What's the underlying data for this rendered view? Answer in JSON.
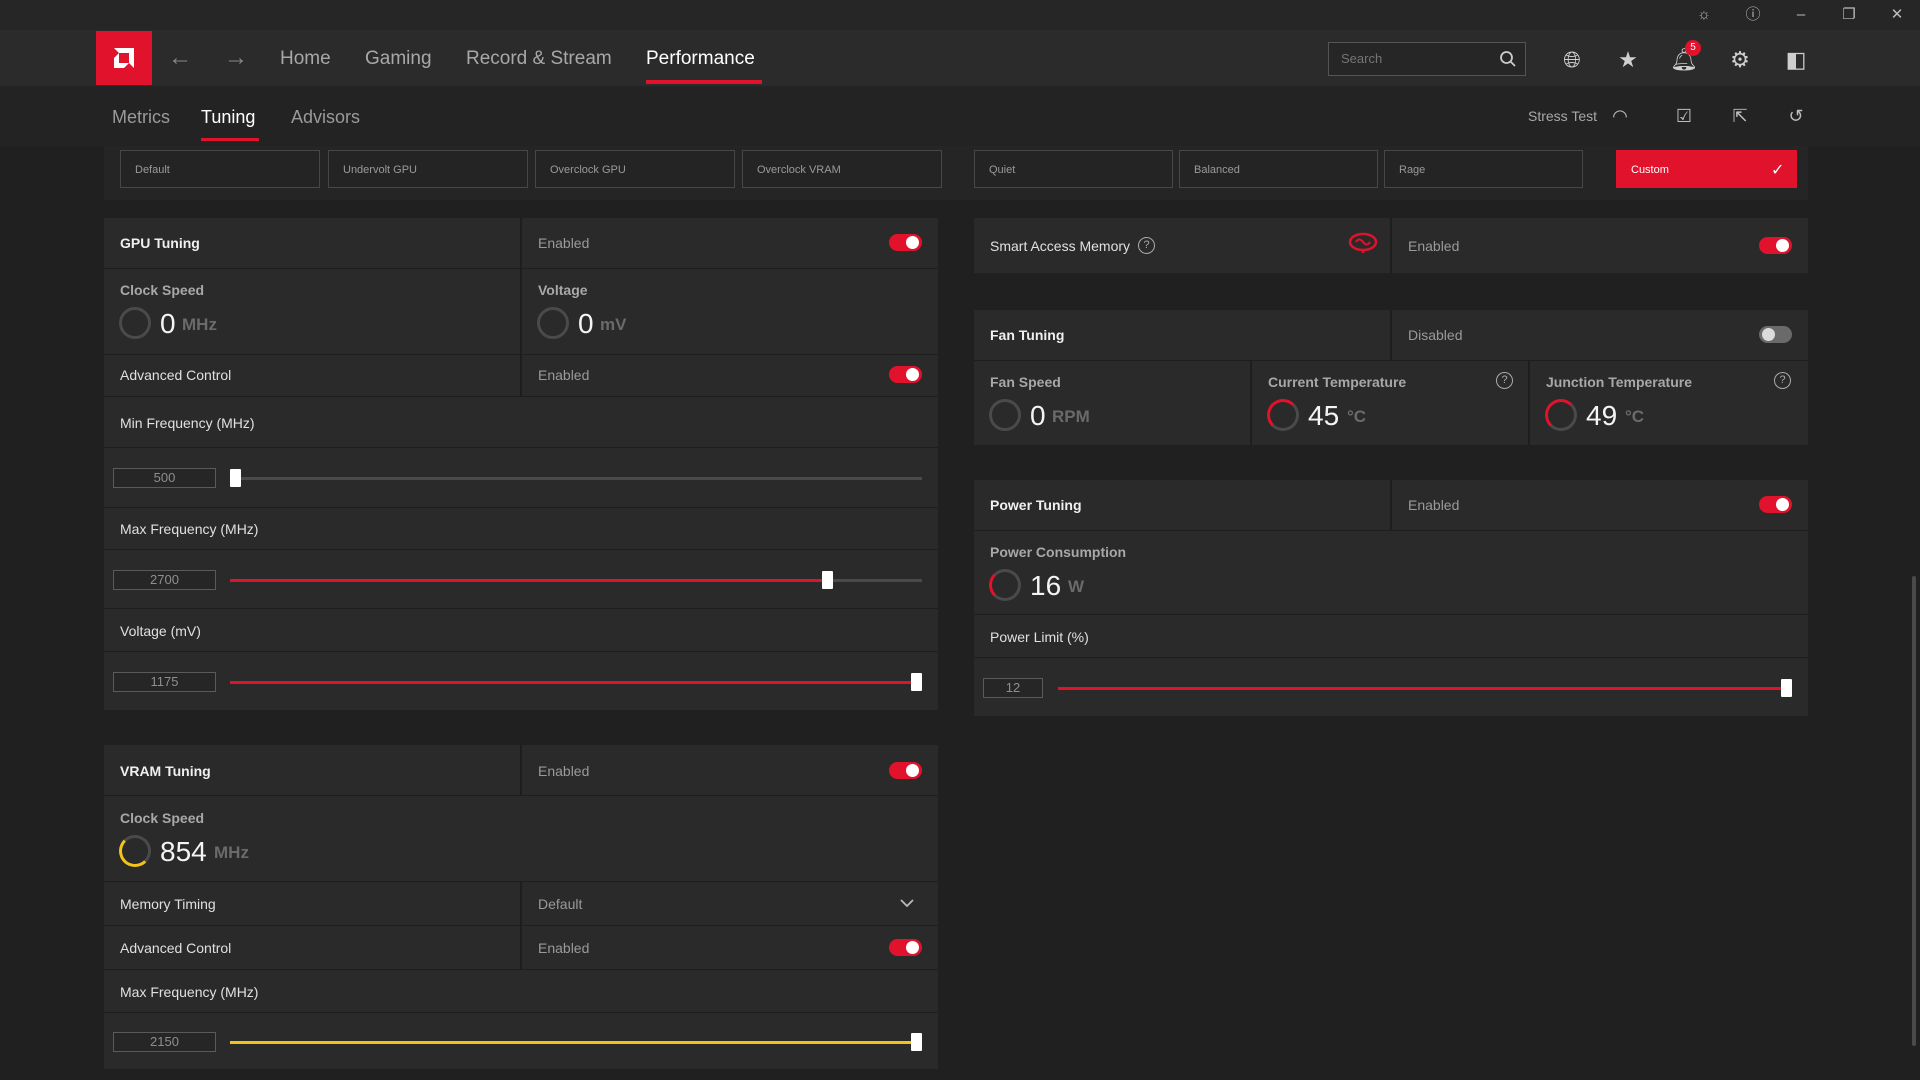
{
  "titlebar": {
    "icons": [
      "bug-icon",
      "help-icon",
      "minimize-icon",
      "restore-icon",
      "close-icon"
    ]
  },
  "nav": {
    "links": [
      "Home",
      "Gaming",
      "Record & Stream",
      "Performance"
    ],
    "active": "Performance",
    "search_placeholder": "Search",
    "notification_count": "5",
    "icons": [
      "globe-icon",
      "star-icon",
      "bell-icon",
      "gear-icon",
      "sidebar-icon"
    ]
  },
  "subnav": {
    "tabs": [
      "Metrics",
      "Tuning",
      "Advisors"
    ],
    "active": "Tuning",
    "stress_test_label": "Stress Test"
  },
  "presets": {
    "gpu": [
      "Default",
      "Undervolt GPU",
      "Overclock GPU",
      "Overclock VRAM"
    ],
    "fan": [
      "Quiet",
      "Balanced",
      "Rage"
    ],
    "selected": "Custom"
  },
  "gpu_tuning": {
    "title": "GPU Tuning",
    "state": "Enabled",
    "enabled": true,
    "clock_label": "Clock Speed",
    "clock_value": "0",
    "clock_unit": "MHz",
    "voltage_label": "Voltage",
    "voltage_value": "0",
    "voltage_unit": "mV",
    "advanced_label": "Advanced Control",
    "advanced_state": "Enabled",
    "advanced_enabled": true,
    "min_freq_label": "Min Frequency (MHz)",
    "min_freq_value": "500",
    "min_freq_fraction": 0.0,
    "max_freq_label": "Max Frequency (MHz)",
    "max_freq_value": "2700",
    "max_freq_fraction": 0.87,
    "voltage_slider_label": "Voltage (mV)",
    "voltage_slider_value": "1175",
    "voltage_slider_fraction": 1.0
  },
  "vram_tuning": {
    "title": "VRAM Tuning",
    "state": "Enabled",
    "enabled": true,
    "clock_label": "Clock Speed",
    "clock_value": "854",
    "clock_unit": "MHz",
    "memory_timing_label": "Memory Timing",
    "memory_timing_value": "Default",
    "advanced_label": "Advanced Control",
    "advanced_state": "Enabled",
    "advanced_enabled": true,
    "max_freq_label": "Max Frequency (MHz)",
    "max_freq_value": "2150",
    "max_freq_fraction": 1.0
  },
  "smart_access_memory": {
    "title": "Smart Access Memory",
    "state": "Enabled",
    "enabled": true
  },
  "fan_tuning": {
    "title": "Fan Tuning",
    "state": "Disabled",
    "enabled": false,
    "fan_speed_label": "Fan Speed",
    "fan_speed_value": "0",
    "fan_speed_unit": "RPM",
    "current_temp_label": "Current Temperature",
    "current_temp_value": "45",
    "current_temp_unit": "°C",
    "junction_temp_label": "Junction Temperature",
    "junction_temp_value": "49",
    "junction_temp_unit": "°C"
  },
  "power_tuning": {
    "title": "Power Tuning",
    "state": "Enabled",
    "enabled": true,
    "consumption_label": "Power Consumption",
    "consumption_value": "16",
    "consumption_unit": "W",
    "limit_label": "Power Limit (%)",
    "limit_value": "12",
    "limit_fraction": 1.0
  },
  "colors": {
    "accent": "#e0122c",
    "vram_accent": "#f2c318",
    "panel": "#2a2a2a",
    "background": "#202020"
  }
}
